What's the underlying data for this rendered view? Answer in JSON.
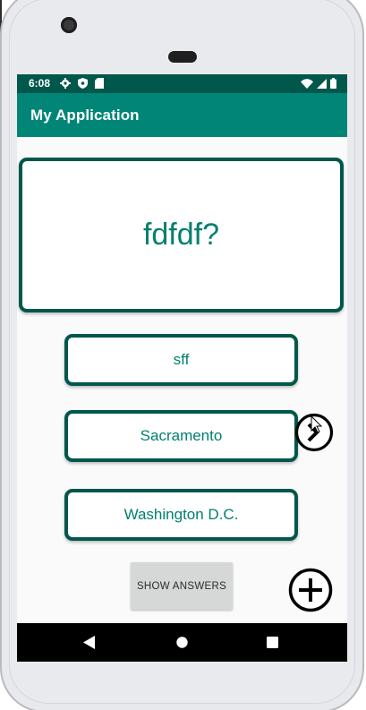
{
  "status_bar": {
    "time": "6:08",
    "icons_left": [
      "gear-icon",
      "shield-icon",
      "sd-card-icon"
    ],
    "icons_right": [
      "wifi-icon",
      "signal-icon",
      "battery-icon"
    ]
  },
  "app_bar": {
    "title": "My Application",
    "color": "#008577",
    "status_color": "#00574b"
  },
  "flashcard": {
    "question": "fdfdf?",
    "answers": [
      "sff",
      "Sacramento",
      "Washington D.C."
    ],
    "accent_color": "#00806f"
  },
  "actions": {
    "show_answers_label": "SHOW ANSWERS",
    "next_icon": "chevron-right-circle-icon",
    "add_icon": "add-circle-icon"
  },
  "nav_bar": {
    "icons": [
      "back-icon",
      "home-icon",
      "recents-icon"
    ]
  }
}
